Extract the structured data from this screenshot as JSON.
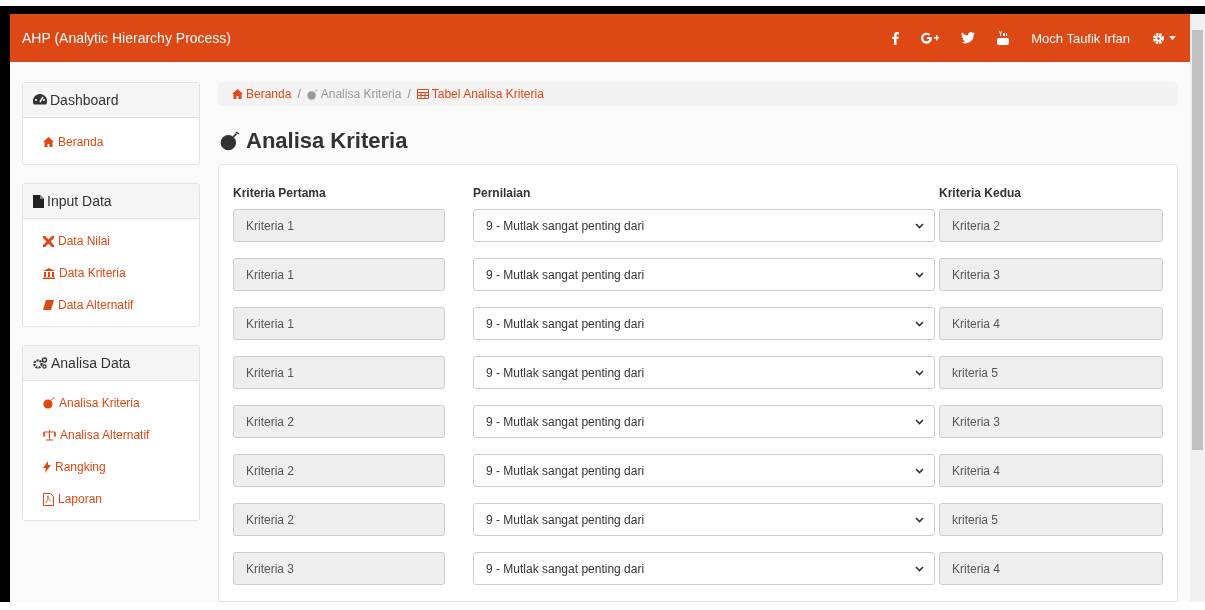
{
  "navbar": {
    "brand": "AHP (Analytic Hierarchy Process)",
    "user": "Moch Taufik Irfan"
  },
  "sidebar": [
    {
      "title": "Dashboard",
      "items": [
        {
          "label": "Beranda"
        }
      ]
    },
    {
      "title": "Input Data",
      "items": [
        {
          "label": "Data Nilai"
        },
        {
          "label": "Data Kriteria"
        },
        {
          "label": "Data Alternatif"
        }
      ]
    },
    {
      "title": "Analisa Data",
      "items": [
        {
          "label": "Analisa Kriteria"
        },
        {
          "label": "Analisa Alternatif"
        },
        {
          "label": "Rangking"
        },
        {
          "label": "Laporan"
        }
      ]
    }
  ],
  "breadcrumb": [
    {
      "label": "Beranda",
      "kind": "link"
    },
    {
      "label": "/",
      "kind": "separator"
    },
    {
      "label": "Analisa Kriteria",
      "kind": "text"
    },
    {
      "label": "/",
      "kind": "separator"
    },
    {
      "label": "Tabel Analisa Kriteria",
      "kind": "link"
    }
  ],
  "page_title": "Analisa Kriteria",
  "table": {
    "columns": [
      "Kriteria Pertama",
      "Pernilaian",
      "Kriteria Kedua"
    ],
    "rows": [
      {
        "first": "Kriteria 1",
        "rating": "9 - Mutlak sangat penting dari",
        "second": "Kriteria 2"
      },
      {
        "first": "Kriteria 1",
        "rating": "9 - Mutlak sangat penting dari",
        "second": "Kriteria 3"
      },
      {
        "first": "Kriteria 1",
        "rating": "9 - Mutlak sangat penting dari",
        "second": "Kriteria 4"
      },
      {
        "first": "Kriteria 1",
        "rating": "9 - Mutlak sangat penting dari",
        "second": "kriteria 5"
      },
      {
        "first": "Kriteria 2",
        "rating": "9 - Mutlak sangat penting dari",
        "second": "Kriteria 3"
      },
      {
        "first": "Kriteria 2",
        "rating": "9 - Mutlak sangat penting dari",
        "second": "Kriteria 4"
      },
      {
        "first": "Kriteria 2",
        "rating": "9 - Mutlak sangat penting dari",
        "second": "kriteria 5"
      },
      {
        "first": "Kriteria 3",
        "rating": "9 - Mutlak sangat penting dari",
        "second": "Kriteria 4"
      }
    ]
  }
}
